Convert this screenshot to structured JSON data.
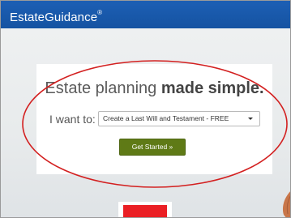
{
  "header": {
    "brand": "EstateGuidance",
    "trademark": "®",
    "background_color": "#1a59ab"
  },
  "hero": {
    "headline_regular": "Estate planning ",
    "headline_bold": "made simple.",
    "want_label": "I want to:",
    "select": {
      "selected_value": "Create a Last Will and Testament - FREE",
      "icon": "chevron-down-icon"
    },
    "cta_label": "Get Started »",
    "cta_color": "#5f7a16"
  },
  "annotation": {
    "shape": "ellipse",
    "color": "#d32020"
  },
  "decor": {
    "red_block_color": "#ea1f24"
  }
}
